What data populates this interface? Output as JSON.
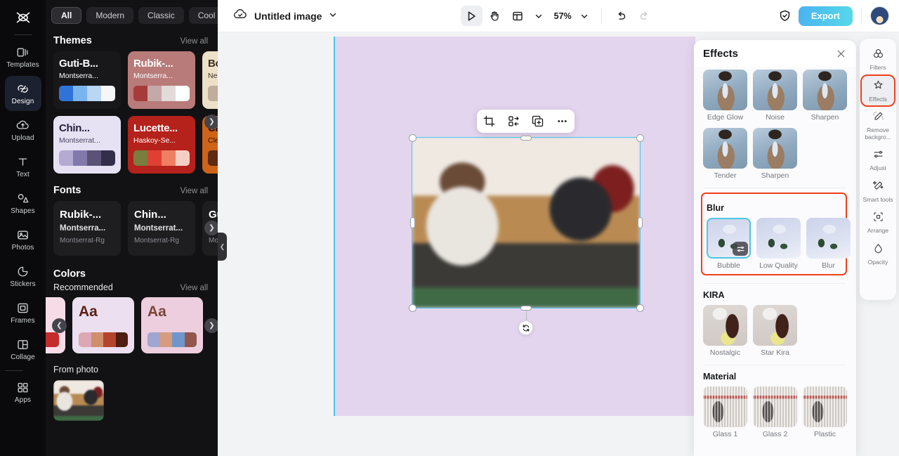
{
  "left_rail": {
    "logo": "capcut-logo",
    "items": [
      {
        "label": "Templates",
        "icon": "templates-icon",
        "active": false
      },
      {
        "label": "Design",
        "icon": "design-icon",
        "active": true
      },
      {
        "label": "Upload",
        "icon": "upload-cloud-icon",
        "active": false
      },
      {
        "label": "Text",
        "icon": "text-icon",
        "active": false
      },
      {
        "label": "Shapes",
        "icon": "shapes-icon",
        "active": false
      },
      {
        "label": "Photos",
        "icon": "photos-icon",
        "active": false
      },
      {
        "label": "Stickers",
        "icon": "stickers-icon",
        "active": false
      },
      {
        "label": "Frames",
        "icon": "frames-icon",
        "active": false
      },
      {
        "label": "Collage",
        "icon": "collage-icon",
        "active": false
      },
      {
        "label": "Apps",
        "icon": "apps-grid-icon",
        "active": false
      }
    ]
  },
  "panel": {
    "chips": [
      {
        "label": "All",
        "active": true
      },
      {
        "label": "Modern",
        "active": false
      },
      {
        "label": "Classic",
        "active": false
      },
      {
        "label": "Cool",
        "active": false
      }
    ],
    "chip_more_icon": "chevron-down-icon",
    "themes": {
      "title": "Themes",
      "view_all": "View all",
      "cards": [
        {
          "title": "Guti-B...",
          "subtitle": "Montserra...",
          "bg": "#18181b",
          "title_color": "#ffffff",
          "sub_color": "#ffffff",
          "swatches": [
            "#2f73d8",
            "#7ab4ef",
            "#b9d6f4",
            "#f4f6f8"
          ]
        },
        {
          "title": "Rubik-...",
          "subtitle": "Montserra...",
          "bg": "#b87b79",
          "title_color": "#ffffff",
          "sub_color": "#ffffff",
          "swatches": [
            "#a63b3b",
            "#c5a8a8",
            "#e3dada",
            "#ffffff"
          ]
        },
        {
          "title": "Bo...",
          "subtitle": "Ne...",
          "bg": "#ece0c8",
          "title_color": "#3b2f20",
          "sub_color": "#3b2f20",
          "swatches": [
            "#bfae9b",
            "#d8cab5"
          ]
        },
        {
          "title": "Chin...",
          "subtitle": "Montserrat...",
          "bg": "#e6e2f4",
          "title_color": "#26223b",
          "sub_color": "#4a4560",
          "swatches": [
            "#b4aad2",
            "#8279ab",
            "#5b5376",
            "#332e49"
          ]
        },
        {
          "title": "Lucette...",
          "subtitle": "Haskoy-Se...",
          "bg": "#b5211b",
          "title_color": "#ffffff",
          "sub_color": "#ffffff",
          "swatches": [
            "#7a7d3e",
            "#e04034",
            "#ef7f63",
            "#f6cfc3"
          ]
        },
        {
          "title": "Ca...",
          "subtitle": "Cle...",
          "bg": "#cf6318",
          "title_color": "#2b1406",
          "sub_color": "#2b1406",
          "swatches": [
            "#5d2a12",
            "#8b4318"
          ]
        }
      ]
    },
    "fonts": {
      "title": "Fonts",
      "view_all": "View all",
      "cards": [
        {
          "l1": "Rubik-...",
          "l2": "Montserra...",
          "l3": "Montserrat-Rg"
        },
        {
          "l1": "Chin...",
          "l2": "Montserrat...",
          "l3": "Montserrat-Rg"
        },
        {
          "l1": "Gu...",
          "l2": "Mor...",
          "l3": "Mon"
        }
      ]
    },
    "colors": {
      "title": "Colors",
      "recommended_label": "Recommended",
      "view_all": "View all",
      "cards": [
        {
          "aa": "",
          "bg": "#f7dce8",
          "swatches": [
            "#c42b2b"
          ]
        },
        {
          "aa": "Aa",
          "bg": "#ece0f0",
          "aa_color": "#5a2114",
          "swatches": [
            "#dda7b6",
            "#cf8f6c",
            "#b4442c",
            "#4d1e11"
          ]
        },
        {
          "aa": "Aa",
          "bg": "#eccede",
          "aa_color": "#7d4438",
          "swatches": [
            "#9fa6d0",
            "#d79b7e",
            "#6e96cb",
            "#92564f"
          ]
        }
      ]
    },
    "from_photo": {
      "title": "From photo"
    },
    "prev_icon": "chevron-left-icon",
    "next_icon": "chevron-right-icon",
    "collapse_icon": "chevron-left-icon"
  },
  "topbar": {
    "cloud_icon": "cloud-check-icon",
    "doc_title": "Untitled image",
    "title_caret_icon": "chevron-down-icon",
    "tools": [
      {
        "name": "select-tool",
        "icon": "cursor-play-icon",
        "selected": true
      },
      {
        "name": "hand-tool",
        "icon": "hand-icon",
        "selected": false
      },
      {
        "name": "layout-tool",
        "icon": "layout-icon",
        "selected": false
      }
    ],
    "layout_caret_icon": "chevron-down-icon",
    "zoom_level": "57%",
    "zoom_caret_icon": "chevron-down-icon",
    "undo_icon": "undo-arrow-icon",
    "redo_icon": "redo-arrow-icon",
    "shield_icon": "shield-check-icon",
    "export_label": "Export",
    "avatar": "user-avatar"
  },
  "canvas": {
    "artboard_color": "#e4d5ef",
    "selection_color": "#47c8e7",
    "floating_toolbar": [
      {
        "name": "crop-button",
        "icon": "crop-icon"
      },
      {
        "name": "replace-button",
        "icon": "swap-icon"
      },
      {
        "name": "duplicate-button",
        "icon": "duplicate-icon"
      },
      {
        "name": "more-button",
        "icon": "more-horizontal-icon"
      }
    ],
    "rotate_icon": "rotate-icon"
  },
  "effects_panel": {
    "title": "Effects",
    "close_icon": "close-icon",
    "sections": [
      {
        "title": "",
        "highlighted": false,
        "items": [
          {
            "label": "Edge Glow",
            "thumb": "suit",
            "selected": false
          },
          {
            "label": "Noise",
            "thumb": "suit",
            "selected": false
          },
          {
            "label": "Sharpen",
            "thumb": "suit",
            "selected": false
          },
          {
            "label": "Tender",
            "thumb": "suit",
            "selected": false
          },
          {
            "label": "Sharpen",
            "thumb": "suit",
            "selected": false
          }
        ]
      },
      {
        "title": "Blur",
        "highlighted": true,
        "items": [
          {
            "label": "Bubble",
            "thumb": "rose",
            "selected": true,
            "badge": "adjust-sliders-icon"
          },
          {
            "label": "Low Quality",
            "thumb": "rose",
            "selected": false
          },
          {
            "label": "Blur",
            "thumb": "rose",
            "selected": false
          }
        ]
      },
      {
        "title": "KIRA",
        "highlighted": false,
        "items": [
          {
            "label": "Nostalgic",
            "thumb": "kira",
            "selected": false
          },
          {
            "label": "Star Kira",
            "thumb": "kira",
            "selected": false
          }
        ]
      },
      {
        "title": "Material",
        "highlighted": false,
        "items": [
          {
            "label": "Glass 1",
            "thumb": "glass",
            "selected": false
          },
          {
            "label": "Glass 2",
            "thumb": "glass",
            "selected": false
          },
          {
            "label": "Plastic",
            "thumb": "glass",
            "selected": false
          }
        ]
      }
    ]
  },
  "right_rail": {
    "items": [
      {
        "label": "Filters",
        "icon": "filters-icon",
        "active": false,
        "highlighted": false
      },
      {
        "label": "Effects",
        "icon": "effects-sparkle-icon",
        "active": true,
        "highlighted": true
      },
      {
        "label": "Remove backgro...",
        "icon": "remove-background-icon",
        "active": false,
        "highlighted": false
      },
      {
        "label": "Adjust",
        "icon": "adjust-sliders-icon",
        "active": false,
        "highlighted": false
      },
      {
        "label": "Smart tools",
        "icon": "magic-wand-icon",
        "active": false,
        "highlighted": false
      },
      {
        "label": "Arrange",
        "icon": "arrange-icon",
        "active": false,
        "highlighted": false
      },
      {
        "label": "Opacity",
        "icon": "opacity-drop-icon",
        "active": false,
        "highlighted": false
      }
    ]
  },
  "colors": {
    "accent": "#47c8e7",
    "highlight": "#f0401a",
    "export_gradient_from": "#49b2f0",
    "export_gradient_to": "#57d9e8"
  }
}
